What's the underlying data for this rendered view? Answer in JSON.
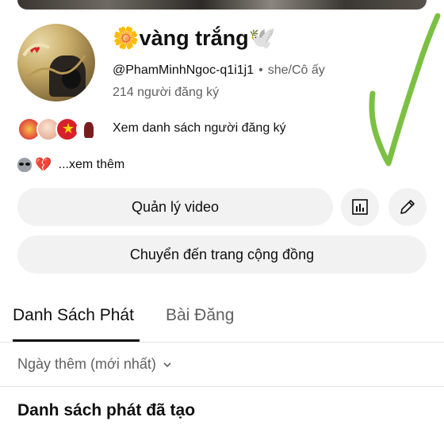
{
  "channel": {
    "name": "🌼vàng trắng🕊️",
    "handle": "@PhamMinhNgoc-q1i1j1",
    "separator": "•",
    "pronouns": "she/Cô ấy",
    "subscribers": "214 người đăng ký"
  },
  "subscribers_link": "Xem danh sách người đăng ký",
  "description": {
    "more_text": "...xem thêm"
  },
  "buttons": {
    "manage_videos": "Quản lý video",
    "community": "Chuyển đến trang cộng đồng",
    "stats_icon": "bar-chart-icon",
    "edit_icon": "pencil-icon"
  },
  "tabs": [
    {
      "label": "Danh Sách Phát",
      "active": true
    },
    {
      "label": "Bài Đăng",
      "active": false
    }
  ],
  "sort": {
    "label": "Ngày thêm (mới nhất)"
  },
  "section": {
    "title": "Danh sách phát đã tạo"
  },
  "colors": {
    "annotation_stroke": "#7bc043",
    "button_bg": "#f2f2f2",
    "secondary_text": "#606060"
  }
}
